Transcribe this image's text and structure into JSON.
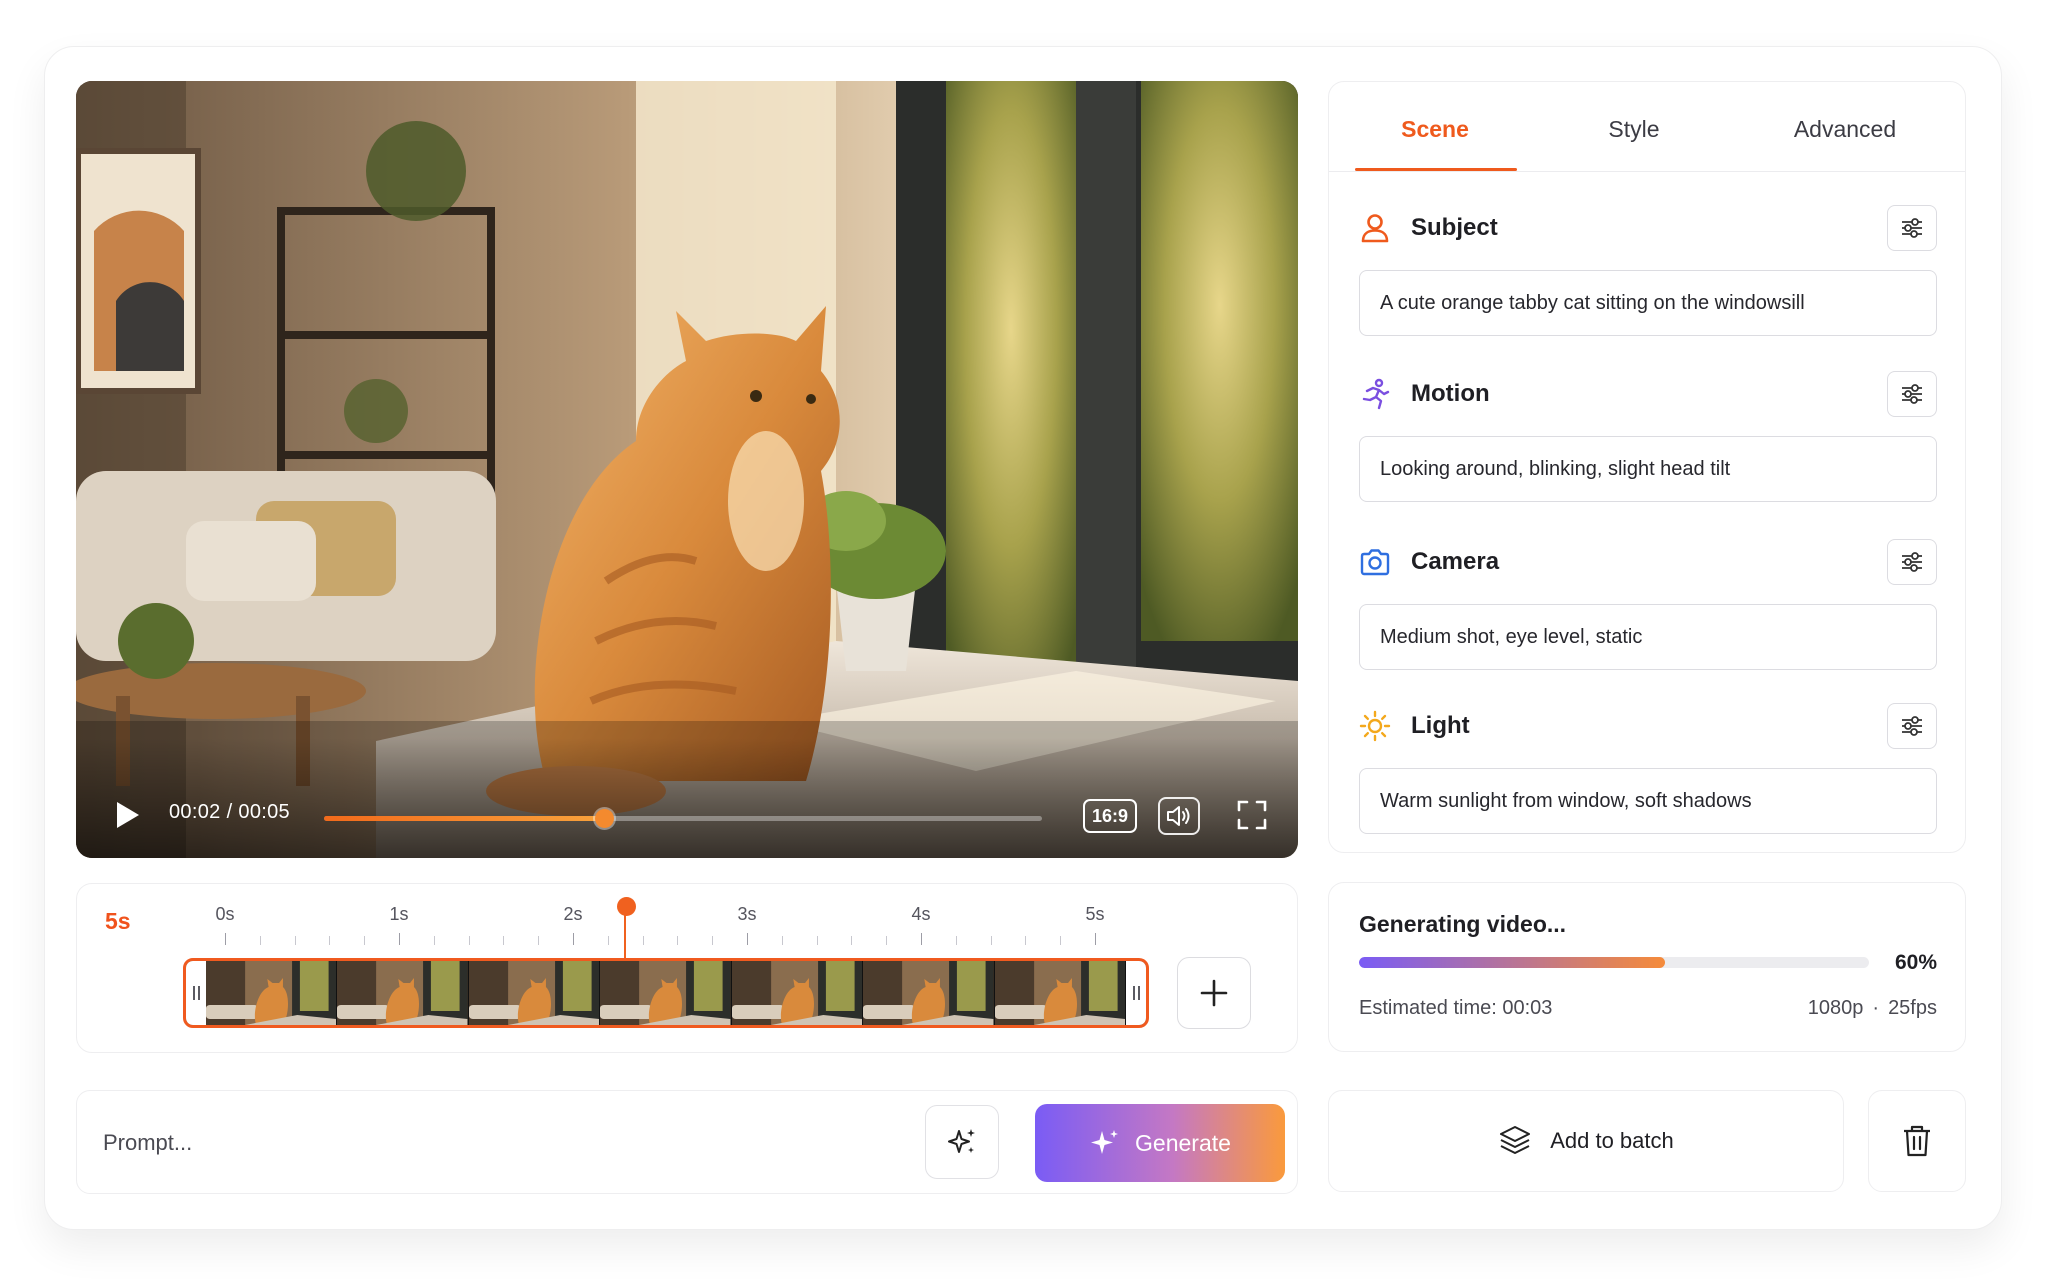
{
  "player": {
    "current_time": "00:02",
    "separator": "/",
    "total_time": "00:05",
    "progress": 0.39,
    "aspect_ratio": "16:9",
    "accent_color": "#f26a1b"
  },
  "timeline": {
    "duration_label": "5s",
    "tick_labels": [
      "0s",
      "1s",
      "2s",
      "3s",
      "4s",
      "5s"
    ],
    "playhead_position": 0.46,
    "add_clip_icon": "plus-icon"
  },
  "prompt": {
    "placeholder": "Prompt...",
    "enhance_icon": "sparkle-icon",
    "generate_label": "Generate",
    "generate_gradient": [
      "#7a5cf5",
      "#fa9a3c"
    ]
  },
  "settings": {
    "tabs": [
      {
        "label": "Scene",
        "active": true
      },
      {
        "label": "Style",
        "active": false
      },
      {
        "label": "Advanced",
        "active": false
      }
    ],
    "sections": [
      {
        "title": "Subject",
        "icon": "user-icon",
        "icon_color": "#ef5a1d",
        "value": "A cute orange tabby cat sitting on the windowsill"
      },
      {
        "title": "Motion",
        "icon": "running-person-icon",
        "icon_color": "#7b4fe0",
        "value": "Looking around, blinking, slight head tilt"
      },
      {
        "title": "Camera",
        "icon": "camera-icon",
        "icon_color": "#2f6fe0",
        "value": "Medium shot, eye level, static"
      },
      {
        "title": "Light",
        "icon": "sun-icon",
        "icon_color": "#f3a81c",
        "value": "Warm sunlight from window, soft shadows"
      }
    ]
  },
  "progress": {
    "title": "Generating video...",
    "percent_label": "60%",
    "percent": 0.6,
    "estimate": "Estimated time: 00:03",
    "resolution": "1080p",
    "spec_separator": "·",
    "fps": "25fps"
  },
  "actions": {
    "add_to_batch_label": "Add to batch",
    "add_to_batch_icon": "layers-icon",
    "delete_icon": "trash-icon"
  }
}
